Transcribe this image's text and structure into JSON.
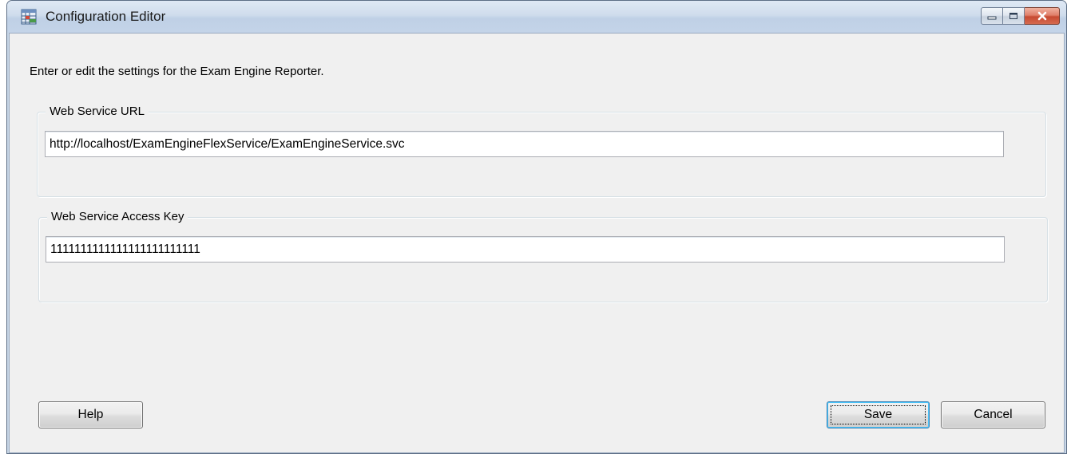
{
  "window": {
    "title": "Configuration Editor",
    "icon": "table-grid-icon"
  },
  "caption": {
    "minimize_icon": "minimize-icon",
    "maximize_icon": "maximize-icon",
    "close_icon": "close-icon"
  },
  "instructions": "Enter or edit the settings for the Exam Engine Reporter.",
  "url_group": {
    "label": "Web Service URL",
    "value": "http://localhost/ExamEngineFlexService/ExamEngineService.svc"
  },
  "key_group": {
    "label": "Web Service Access Key",
    "value": "1111111111111111111111111"
  },
  "buttons": {
    "help": "Help",
    "save": "Save",
    "cancel": "Cancel"
  },
  "colors": {
    "window_frame": "#c9d7e8",
    "client_bg": "#f0f0f0",
    "close_button": "#c74a32"
  }
}
